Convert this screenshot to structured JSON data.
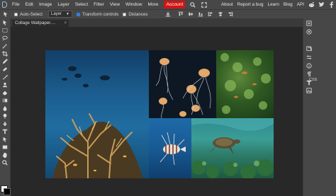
{
  "menubar": {
    "items": [
      "File",
      "Edit",
      "Image",
      "Layer",
      "Select",
      "Filter",
      "View",
      "Window",
      "More"
    ],
    "account": "Account",
    "right_links": [
      "About",
      "Report a bug",
      "Learn",
      "Blog",
      "API"
    ],
    "accent": "#d11414"
  },
  "options": {
    "auto_select": "Auto-Select",
    "layer_select": "Layer",
    "transform": "Transform controls",
    "distances": "Distances"
  },
  "document": {
    "tab_title": "Collage Wallpaper.…",
    "tab_close": "×"
  },
  "panel": {
    "css_label": "CSS"
  },
  "icons": {
    "menubar": [
      "search-icon",
      "fullscreen-icon"
    ],
    "social": [
      "reddit-icon",
      "twitter-icon",
      "facebook-icon"
    ],
    "tools": [
      "move-icon",
      "marquee-icon",
      "lasso-icon",
      "magic-wand-icon",
      "crop-icon",
      "eyedropper-icon",
      "healing-brush-icon",
      "brush-icon",
      "clone-stamp-icon",
      "eraser-icon",
      "fill-icon",
      "blur-icon",
      "dodge-icon",
      "pen-icon",
      "type-icon",
      "path-select-icon",
      "shape-icon",
      "hand-icon",
      "zoom-icon"
    ]
  }
}
